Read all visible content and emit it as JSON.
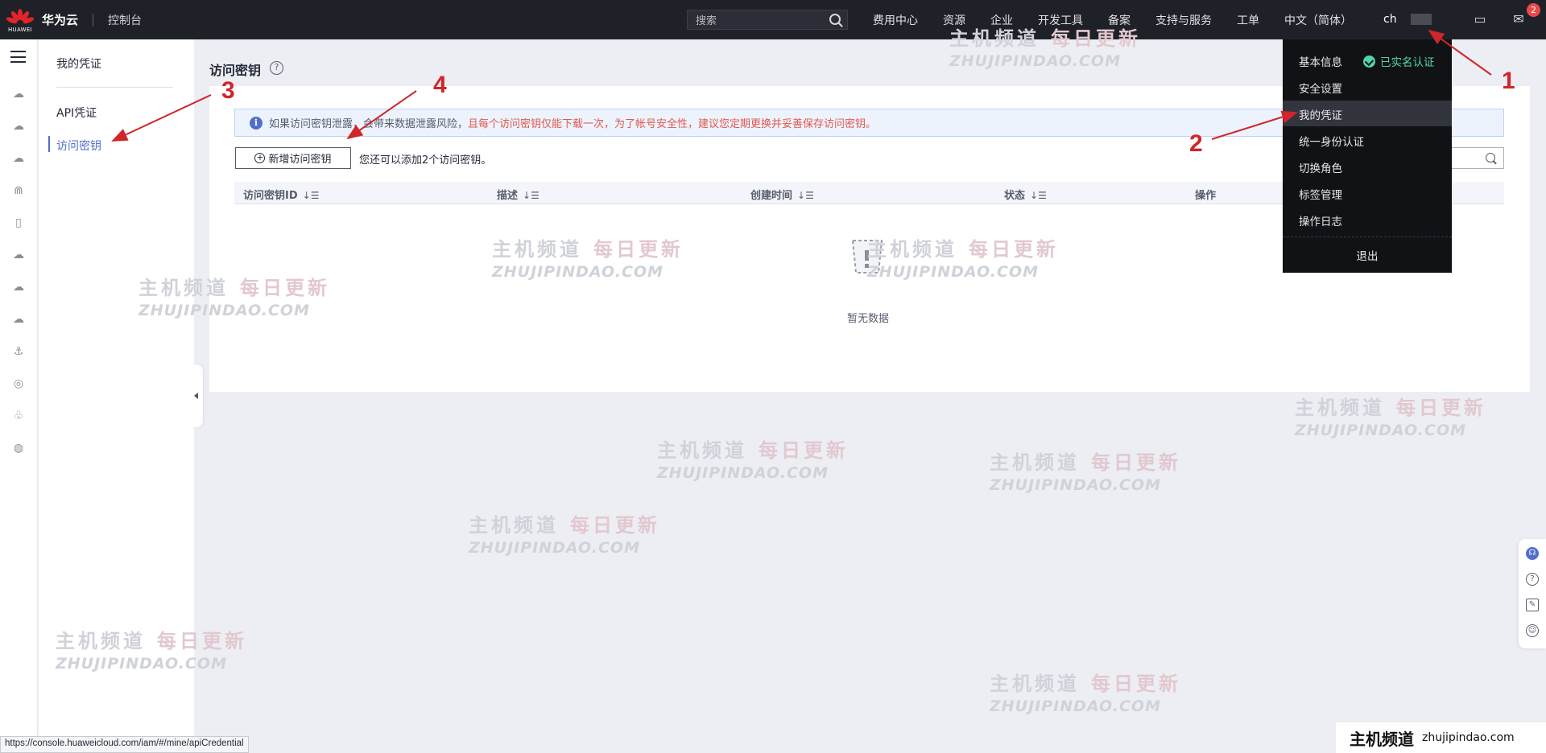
{
  "topbar": {
    "logo_text": "HUAWEI",
    "brand": "华为云",
    "console": "控制台",
    "search_placeholder": "搜索",
    "nav": [
      "费用中心",
      "资源",
      "企业",
      "开发工具",
      "备案",
      "支持与服务",
      "工单",
      "中文（简体）"
    ],
    "user": "ch",
    "message_count": "2"
  },
  "sidebar": {
    "title": "我的凭证",
    "items": [
      "API凭证",
      "访问密钥"
    ],
    "active": "访问密钥"
  },
  "main": {
    "title": "访问密钥",
    "notice_normal": "如果访问密钥泄露，会带来数据泄露风险，",
    "notice_warning": "且每个访问密钥仅能下载一次，为了帐号安全性，建议您定期更换并妥善保存访问密钥。",
    "add_button": "新增访问密钥",
    "hint": "您还可以添加2个访问密钥。",
    "columns": [
      "访问密钥ID",
      "描述",
      "创建时间",
      "状态",
      "操作"
    ],
    "empty_text": "暂无数据"
  },
  "dropdown": {
    "items": [
      "基本信息",
      "安全设置",
      "我的凭证",
      "统一身份认证",
      "切换角色",
      "标签管理",
      "操作日志"
    ],
    "verified": "已实名认证",
    "logout": "退出",
    "active": "我的凭证"
  },
  "statusbar": {
    "url": "https://console.huaweicloud.com/iam/#/mine/apiCredential"
  },
  "branding": {
    "cn": "主机频道",
    "en": "zhujipindao.com"
  },
  "watermark": {
    "line1": "主机频道",
    "line1_tag": "每日更新",
    "line2": "ZHUJIPINDAO.COM"
  },
  "annotations": [
    "1",
    "2",
    "3",
    "4"
  ],
  "colors": {
    "accent": "#526ecc",
    "warning": "#e0584e",
    "verified": "#50d4ab",
    "annotation": "#d0252a",
    "topbar": "#1f2128"
  }
}
